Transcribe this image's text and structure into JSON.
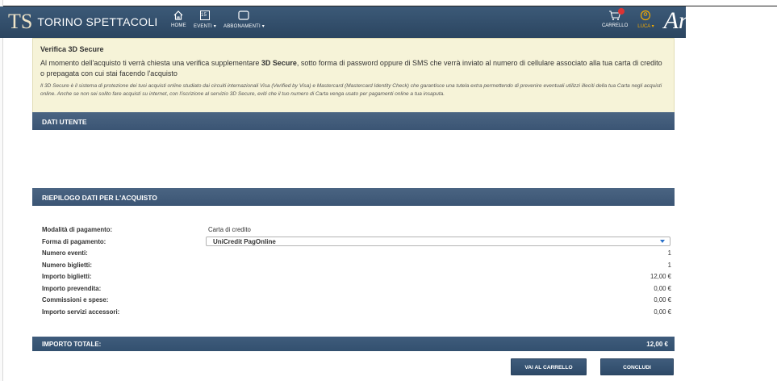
{
  "header": {
    "logo_mark": "TS",
    "brand": "TORINO SPETTACOLI",
    "nav": [
      {
        "label": "HOME",
        "icon": "home-icon"
      },
      {
        "label": "EVENTI",
        "icon": "calendar-icon",
        "calendar_day": "15"
      },
      {
        "label": "ABBONAMENTI",
        "icon": "ticket-icon"
      }
    ],
    "cart_label": "CARRELLO",
    "user_label": "LUCA",
    "script_logo": "An"
  },
  "notice": {
    "title": "Verifica 3D Secure",
    "lead_before": "Al momento dell'acquisto ti verrà chiesta una verifica supplementare ",
    "lead_bold": "3D Secure",
    "lead_after": ", sotto forma di password oppure di SMS che verrà inviato al numero di cellulare associato alla tua carta di credito o prepagata con cui stai facendo l'acquisto",
    "small": "Il 3D Secure è il sistema di protezione dei tuoi acquisti online studiato dai circuiti internazionali Visa (Verified by Visa) e Mastercard (Mastercard Identity Check) che garantisce una tutela extra permettendo di prevenire eventuali utilizzi illeciti della tua Carta negli acquisti online. Anche se non sei solito fare acquisti su internet, con l'iscrizione al servizio 3D Secure, eviti che il tuo numero di Carta venga usato per pagamenti online a tua insaputa."
  },
  "sections": {
    "user": "DATI UTENTE",
    "summary": "RIEPILOGO DATI PER L'ACQUISTO"
  },
  "summary": {
    "payment_mode_label": "Modalità di pagamento:",
    "payment_mode_value": "Carta di credito",
    "payment_form_label": "Forma di pagamento:",
    "payment_form_value": "UniCredit PagOnline",
    "rows": [
      {
        "label": "Numero eventi:",
        "value": "1"
      },
      {
        "label": "Numero biglietti:",
        "value": "1"
      },
      {
        "label": "Importo biglietti:",
        "value": "12,00 €"
      },
      {
        "label": "Importo prevendita:",
        "value": "0,00 €"
      },
      {
        "label": "Commissioni e spese:",
        "value": "0,00 €"
      },
      {
        "label": "Importo servizi accessori:",
        "value": "0,00 €"
      }
    ],
    "total_label": "IMPORTO TOTALE:",
    "total_value": "12,00 €"
  },
  "buttons": {
    "cart": "VAI AL CARRELLO",
    "finish": "CONCLUDI"
  },
  "colors": {
    "header": "#2f4a66",
    "accent": "#f2a900",
    "notice_bg": "#f6f3d8"
  }
}
